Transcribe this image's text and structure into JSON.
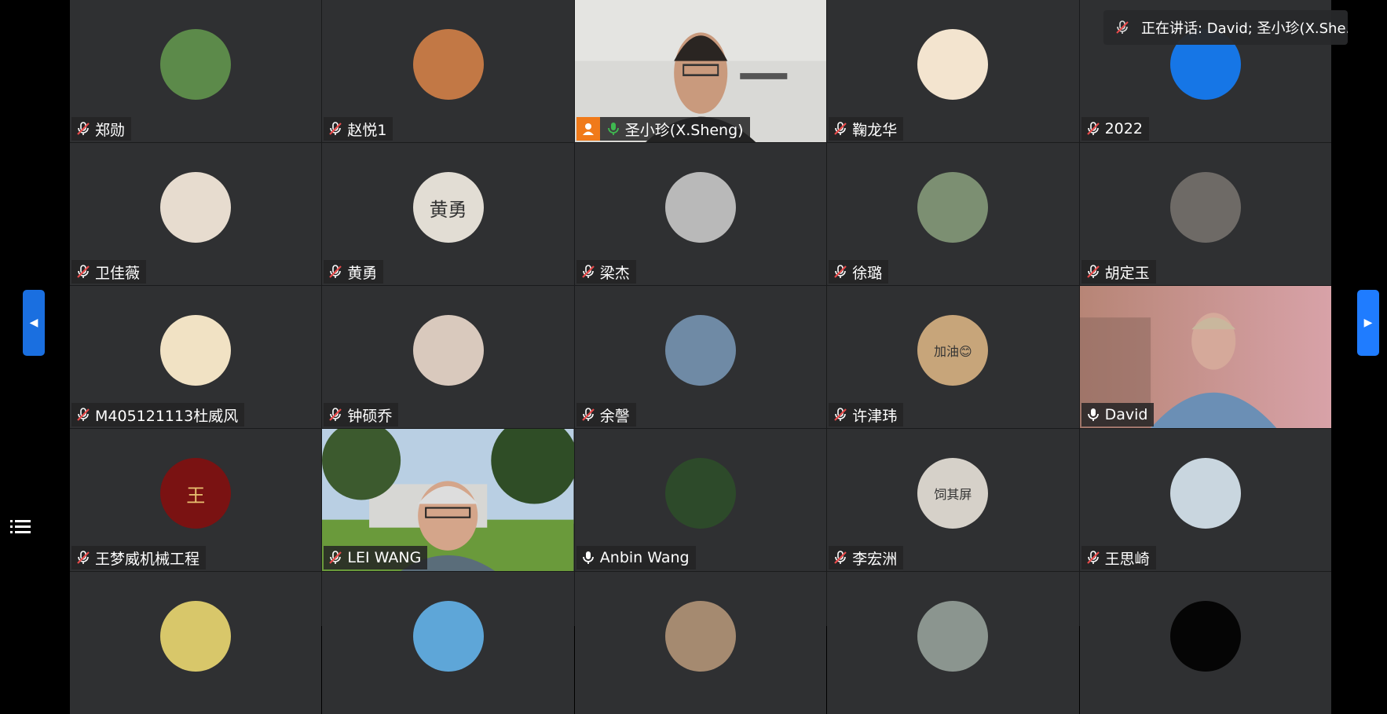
{
  "colors": {
    "tile_bg": "#2f3032",
    "name_bg": "#232325",
    "mic_muted": "#e84a4a",
    "mic_active": "#3fb950",
    "accent_blue": "#1f7cff",
    "host_orange": "#f07a1a"
  },
  "speaking_banner": {
    "icon": "muted-mic-icon",
    "text": "正在讲话: David; 圣小珍(X.Sheng)",
    "display_text": "正在讲话: David; 圣小珍(X.She..."
  },
  "navigation": {
    "prev_icon": "chevron-left-icon",
    "next_icon": "chevron-right-icon",
    "list_icon": "participant-list-icon"
  },
  "participants": [
    {
      "name": "郑勋",
      "mic": "muted",
      "kind": "avatar",
      "avatar_icon": "panda-avatar",
      "avatar_color": "#5c8a4a"
    },
    {
      "name": "赵悦1",
      "mic": "muted",
      "kind": "avatar",
      "avatar_icon": "basketball-avatar",
      "avatar_color": "#c27845"
    },
    {
      "name": "圣小珍(X.Sheng)",
      "mic": "active",
      "kind": "video",
      "video_icon": "man-at-desk-video",
      "host": true
    },
    {
      "name": "鞠龙华",
      "mic": "muted",
      "kind": "avatar",
      "avatar_icon": "cartoon-baby-avatar",
      "avatar_color": "#f3e4cf"
    },
    {
      "name": "2022",
      "mic": "muted",
      "kind": "avatar",
      "avatar_icon": "blue-circle-avatar",
      "avatar_color": "#1676e6"
    },
    {
      "name": "卫佳薇",
      "mic": "muted",
      "kind": "avatar",
      "avatar_icon": "anime-girl-avatar",
      "avatar_color": "#e7dccf"
    },
    {
      "name": "黄勇",
      "mic": "muted",
      "kind": "avatar",
      "avatar_icon": "calligraphy-avatar",
      "avatar_color": "#e2ddd4",
      "avatar_text": "黄勇"
    },
    {
      "name": "梁杰",
      "mic": "muted",
      "kind": "avatar",
      "avatar_icon": "husky-dog-avatar",
      "avatar_color": "#b9b9b9"
    },
    {
      "name": "徐璐",
      "mic": "muted",
      "kind": "avatar",
      "avatar_icon": "man-in-suit-avatar",
      "avatar_color": "#7c8f72"
    },
    {
      "name": "胡定玉",
      "mic": "muted",
      "kind": "avatar",
      "avatar_icon": "parent-with-baby-avatar",
      "avatar_color": "#6e6a66"
    },
    {
      "name": "M405121113杜威风",
      "mic": "muted",
      "kind": "avatar",
      "avatar_icon": "cartoon-fox-avatar",
      "avatar_color": "#f1e2c4"
    },
    {
      "name": "钟硕乔",
      "mic": "muted",
      "kind": "avatar",
      "avatar_icon": "woman-portrait-avatar",
      "avatar_color": "#d9c9bd"
    },
    {
      "name": "余謦",
      "mic": "muted",
      "kind": "avatar",
      "avatar_icon": "mountain-landscape-avatar",
      "avatar_color": "#6f8aa5"
    },
    {
      "name": "许津玮",
      "mic": "muted",
      "kind": "avatar",
      "avatar_icon": "cheer-sign-avatar",
      "avatar_color": "#c7a57a",
      "avatar_text": "加油😊"
    },
    {
      "name": "David",
      "mic": "on",
      "kind": "video",
      "video_icon": "man-in-sweater-video",
      "speaking": true
    },
    {
      "name": "王梦威机械工程",
      "mic": "muted",
      "kind": "avatar",
      "avatar_icon": "red-seal-avatar",
      "avatar_color": "#7a1212",
      "avatar_text": "王"
    },
    {
      "name": "LEI WANG",
      "mic": "muted",
      "kind": "video",
      "video_icon": "man-outdoors-video"
    },
    {
      "name": "Anbin Wang",
      "mic": "on",
      "kind": "avatar",
      "avatar_icon": "red-flower-avatar",
      "avatar_color": "#2d4a2a"
    },
    {
      "name": "李宏洲",
      "mic": "muted",
      "kind": "avatar",
      "avatar_icon": "drink-can-avatar",
      "avatar_color": "#d6d1c9",
      "avatar_text": "饲其屏"
    },
    {
      "name": "王思崎",
      "mic": "muted",
      "kind": "avatar",
      "avatar_icon": "bird-lake-avatar",
      "avatar_color": "#c9d6df"
    },
    {
      "name": "",
      "mic": "none",
      "kind": "avatar",
      "avatar_icon": "sleeping-dog-avatar",
      "avatar_color": "#d8c76a"
    },
    {
      "name": "",
      "mic": "none",
      "kind": "avatar",
      "avatar_icon": "toy-castle-avatar",
      "avatar_color": "#5ea6d8"
    },
    {
      "name": "",
      "mic": "none",
      "kind": "avatar",
      "avatar_icon": "cat-avatar",
      "avatar_color": "#a58a70"
    },
    {
      "name": "",
      "mic": "none",
      "kind": "avatar",
      "avatar_icon": "river-landscape-avatar",
      "avatar_color": "#8b958f"
    },
    {
      "name": "",
      "mic": "none",
      "kind": "avatar",
      "avatar_icon": "dark-moon-avatar",
      "avatar_color": "#050505"
    }
  ]
}
